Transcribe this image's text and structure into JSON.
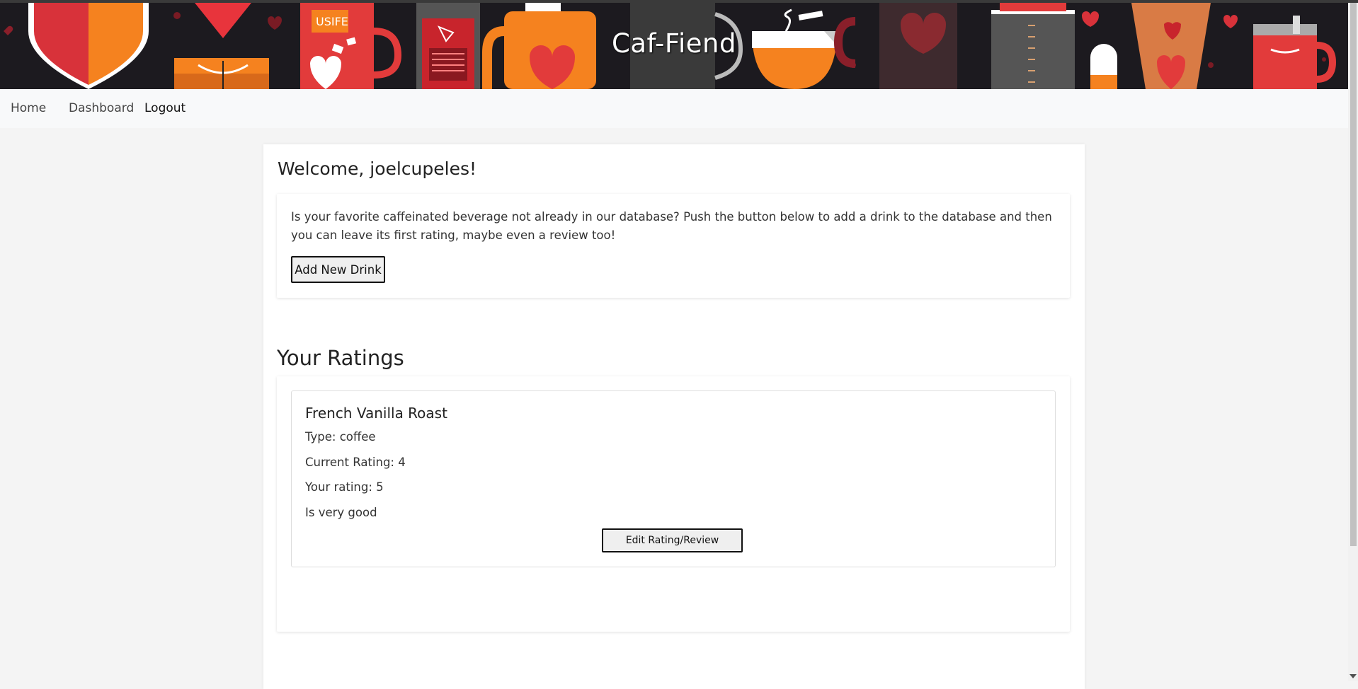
{
  "site": {
    "title": "Caf-Fiend"
  },
  "nav": {
    "home": "Home",
    "dashboard": "Dashboard",
    "logout": "Logout"
  },
  "welcome": "Welcome, joelcupeles!",
  "intro": {
    "text": "Is your favorite caffeinated beverage not already in our database? Push the button below to add a drink to the database and then you can leave its first rating, maybe even a review too!",
    "button": "Add New Drink"
  },
  "ratings": {
    "heading": "Your Ratings",
    "items": [
      {
        "name": "French Vanilla Roast",
        "type": "Type: coffee",
        "current": "Current Rating: 4",
        "yours": "Your rating: 5",
        "review": "Is very good",
        "button": "Edit Rating/Review"
      }
    ]
  },
  "banner_decor": {
    "logo_cup_text": "USIFE",
    "icons": [
      "heart-icon",
      "cup-icon",
      "mug-icon",
      "jug-icon",
      "bowl-icon",
      "tumbler-icon",
      "pill-icon"
    ]
  },
  "colors": {
    "orange": "#f5821f",
    "red": "#d8323a",
    "banner_bg": "#1c1a1f"
  }
}
